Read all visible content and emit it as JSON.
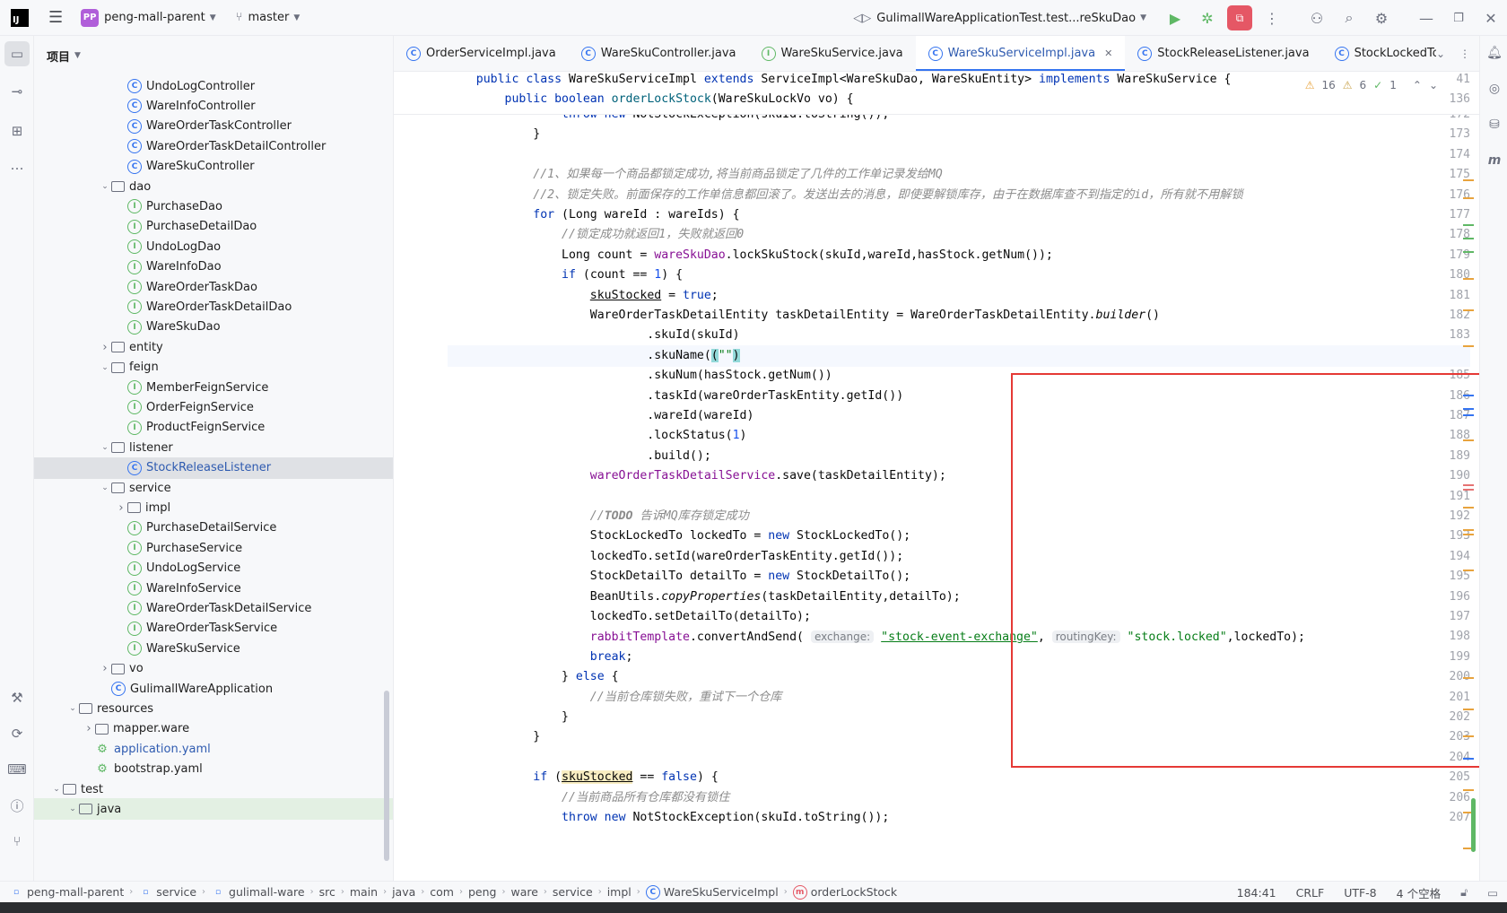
{
  "window": {
    "logo_text": "IJ",
    "project_badge": "PP",
    "project_name": "peng-mall-parent",
    "branch": "master",
    "run_config": "GulimallWareApplicationTest.test...reSkuDao"
  },
  "project_panel": {
    "title": "项目",
    "items": [
      {
        "label": "UndoLogController",
        "kind": "class",
        "depth": 5
      },
      {
        "label": "WareInfoController",
        "kind": "class",
        "depth": 5
      },
      {
        "label": "WareOrderTaskController",
        "kind": "class",
        "depth": 5
      },
      {
        "label": "WareOrderTaskDetailController",
        "kind": "class",
        "depth": 5
      },
      {
        "label": "WareSkuController",
        "kind": "class",
        "depth": 5
      },
      {
        "label": "dao",
        "kind": "folder",
        "depth": 4,
        "state": "open"
      },
      {
        "label": "PurchaseDao",
        "kind": "interface",
        "depth": 5
      },
      {
        "label": "PurchaseDetailDao",
        "kind": "interface",
        "depth": 5
      },
      {
        "label": "UndoLogDao",
        "kind": "interface",
        "depth": 5
      },
      {
        "label": "WareInfoDao",
        "kind": "interface",
        "depth": 5
      },
      {
        "label": "WareOrderTaskDao",
        "kind": "interface",
        "depth": 5
      },
      {
        "label": "WareOrderTaskDetailDao",
        "kind": "interface",
        "depth": 5
      },
      {
        "label": "WareSkuDao",
        "kind": "interface",
        "depth": 5
      },
      {
        "label": "entity",
        "kind": "folder",
        "depth": 4,
        "state": "closed"
      },
      {
        "label": "feign",
        "kind": "folder",
        "depth": 4,
        "state": "open"
      },
      {
        "label": "MemberFeignService",
        "kind": "interface",
        "depth": 5
      },
      {
        "label": "OrderFeignService",
        "kind": "interface",
        "depth": 5
      },
      {
        "label": "ProductFeignService",
        "kind": "interface",
        "depth": 5
      },
      {
        "label": "listener",
        "kind": "folder",
        "depth": 4,
        "state": "open"
      },
      {
        "label": "StockReleaseListener",
        "kind": "class",
        "depth": 5,
        "selected": true
      },
      {
        "label": "service",
        "kind": "folder",
        "depth": 4,
        "state": "open"
      },
      {
        "label": "impl",
        "kind": "folder",
        "depth": 5,
        "state": "closed"
      },
      {
        "label": "PurchaseDetailService",
        "kind": "interface",
        "depth": 5
      },
      {
        "label": "PurchaseService",
        "kind": "interface",
        "depth": 5
      },
      {
        "label": "UndoLogService",
        "kind": "interface",
        "depth": 5
      },
      {
        "label": "WareInfoService",
        "kind": "interface",
        "depth": 5
      },
      {
        "label": "WareOrderTaskDetailService",
        "kind": "interface",
        "depth": 5
      },
      {
        "label": "WareOrderTaskService",
        "kind": "interface",
        "depth": 5
      },
      {
        "label": "WareSkuService",
        "kind": "interface",
        "depth": 5
      },
      {
        "label": "vo",
        "kind": "folder",
        "depth": 4,
        "state": "closed"
      },
      {
        "label": "GulimallWareApplication",
        "kind": "app",
        "depth": 4
      },
      {
        "label": "resources",
        "kind": "folder",
        "depth": 2,
        "state": "open"
      },
      {
        "label": "mapper.ware",
        "kind": "folder",
        "depth": 3,
        "state": "closed"
      },
      {
        "label": "application.yaml",
        "kind": "yaml",
        "depth": 3,
        "blue": true
      },
      {
        "label": "bootstrap.yaml",
        "kind": "yaml",
        "depth": 3
      },
      {
        "label": "test",
        "kind": "folder",
        "depth": 1,
        "state": "open"
      },
      {
        "label": "java",
        "kind": "folder",
        "depth": 2,
        "state": "open",
        "highlight": true
      }
    ]
  },
  "tabs": [
    {
      "label": "OrderServiceImpl.java",
      "kind": "class"
    },
    {
      "label": "WareSkuController.java",
      "kind": "class"
    },
    {
      "label": "WareSkuService.java",
      "kind": "interface"
    },
    {
      "label": "WareSkuServiceImpl.java",
      "kind": "class",
      "active": true
    },
    {
      "label": "StockReleaseListener.java",
      "kind": "class"
    },
    {
      "label": "StockLockedTo.jav",
      "kind": "class"
    }
  ],
  "inspections": {
    "warnings": "16",
    "weak_warnings": "6",
    "ok": "1"
  },
  "sticky_lines": [
    {
      "num": "41",
      "html": "    <span class='kw'>public class</span> WareSkuServiceImpl <span class='kw'>extends</span> ServiceImpl&lt;WareSkuDao, WareSkuEntity&gt; <span class='kw'>implements</span> WareSkuService {"
    },
    {
      "num": "136",
      "html": "        <span class='kw'>public boolean</span> <span class='mtd'>orderLockStock</span>(WareSkuLockVo vo) {"
    }
  ],
  "code_lines": [
    {
      "num": "172",
      "html": "                <span class='kw'>throw new</span> NotStockException(skuId.toString());"
    },
    {
      "num": "173",
      "html": "            }"
    },
    {
      "num": "174",
      "html": ""
    },
    {
      "num": "175",
      "html": "            <span class='cmt'>//1、如果每一个商品都锁定成功,将当前商品锁定了几件的工作单记录发给MQ</span>"
    },
    {
      "num": "176",
      "html": "            <span class='cmt'>//2、锁定失败。前面保存的工作单信息都回滚了。发送出去的消息，即使要解锁库存，由于在数据库查不到指定的id，所有就不用解锁</span>"
    },
    {
      "num": "177",
      "html": "            <span class='kw'>for</span> (Long wareId : wareIds) {"
    },
    {
      "num": "178",
      "html": "                <span class='cmt'>//锁定成功就返回1，失败就返回0</span>"
    },
    {
      "num": "179",
      "html": "                Long count = <span class='fld'>wareSkuDao</span>.lockSkuStock(skuId,wareId,hasStock.getNum());"
    },
    {
      "num": "180",
      "html": "                <span class='kw'>if</span> (count == <span class='num'>1</span>) {"
    },
    {
      "num": "181",
      "html": "                    <span class='underline'>skuStocked</span> = <span class='kw'>true</span>;"
    },
    {
      "num": "182",
      "html": "                    WareOrderTaskDetailEntity taskDetailEntity = WareOrderTaskDetailEntity.<span class='static'>builder</span>()"
    },
    {
      "num": "183",
      "html": "                            .skuId(skuId)"
    },
    {
      "num": "184",
      "html": "                            .skuName(<span class='brhl'>(</span><span class='str'>\"\"</span><span class='brhl'>)</span>",
      "current": true
    },
    {
      "num": "185",
      "html": "                            .skuNum(hasStock.getNum())"
    },
    {
      "num": "186",
      "html": "                            .taskId(wareOrderTaskEntity.getId())"
    },
    {
      "num": "187",
      "html": "                            .wareId(wareId)"
    },
    {
      "num": "188",
      "html": "                            .lockStatus(<span class='num'>1</span>)"
    },
    {
      "num": "189",
      "html": "                            .build();"
    },
    {
      "num": "190",
      "html": "                    <span class='fld'>wareOrderTaskDetailService</span>.save(taskDetailEntity);"
    },
    {
      "num": "191",
      "html": ""
    },
    {
      "num": "192",
      "html": "                    <span class='cmt'>//<b>TODO</b> 告诉MQ库存锁定成功</span>"
    },
    {
      "num": "193",
      "html": "                    StockLockedTo lockedTo = <span class='kw'>new</span> StockLockedTo();"
    },
    {
      "num": "194",
      "html": "                    lockedTo.setId(wareOrderTaskEntity.getId());"
    },
    {
      "num": "195",
      "html": "                    StockDetailTo detailTo = <span class='kw'>new</span> StockDetailTo();"
    },
    {
      "num": "196",
      "html": "                    BeanUtils.<span class='static'>copyProperties</span>(taskDetailEntity,detailTo);"
    },
    {
      "num": "197",
      "html": "                    lockedTo.setDetailTo(detailTo);"
    },
    {
      "num": "198",
      "html": "                    <span class='fld'>rabbitTemplate</span>.convertAndSend( <span class='hint'>exchange:</span> <span class='str underline'>\"stock-event-exchange\"</span>, <span class='hint'>routingKey:</span> <span class='str'>\"stock.locked\"</span>,lockedTo);"
    },
    {
      "num": "199",
      "html": "                    <span class='kw'>break</span>;"
    },
    {
      "num": "200",
      "html": "                } <span class='kw'>else</span> {"
    },
    {
      "num": "201",
      "html": "                    <span class='cmt'>//当前仓库锁失败，重试下一个仓库</span>"
    },
    {
      "num": "202",
      "html": "                }"
    },
    {
      "num": "203",
      "html": "            }"
    },
    {
      "num": "204",
      "html": ""
    },
    {
      "num": "205",
      "html": "            <span class='kw'>if</span> (<span class='varhl underline'>skuStocked</span> == <span class='kw'>false</span>) {"
    },
    {
      "num": "206",
      "html": "                <span class='cmt'>//当前商品所有仓库都没有锁住</span>"
    },
    {
      "num": "207",
      "html": "                <span class='kw'>throw new</span> NotStockException(skuId.toString());"
    }
  ],
  "breadcrumb": [
    "peng-mall-parent",
    "service",
    "gulimall-ware",
    "src",
    "main",
    "java",
    "com",
    "peng",
    "ware",
    "service",
    "impl",
    "WareSkuServiceImpl",
    "orderLockStock"
  ],
  "status": {
    "position": "184:41",
    "line_sep": "CRLF",
    "encoding": "UTF-8",
    "indent": "4 个空格"
  },
  "colors": {
    "accent": "#3574f0",
    "highlight_box": "#e53935"
  }
}
